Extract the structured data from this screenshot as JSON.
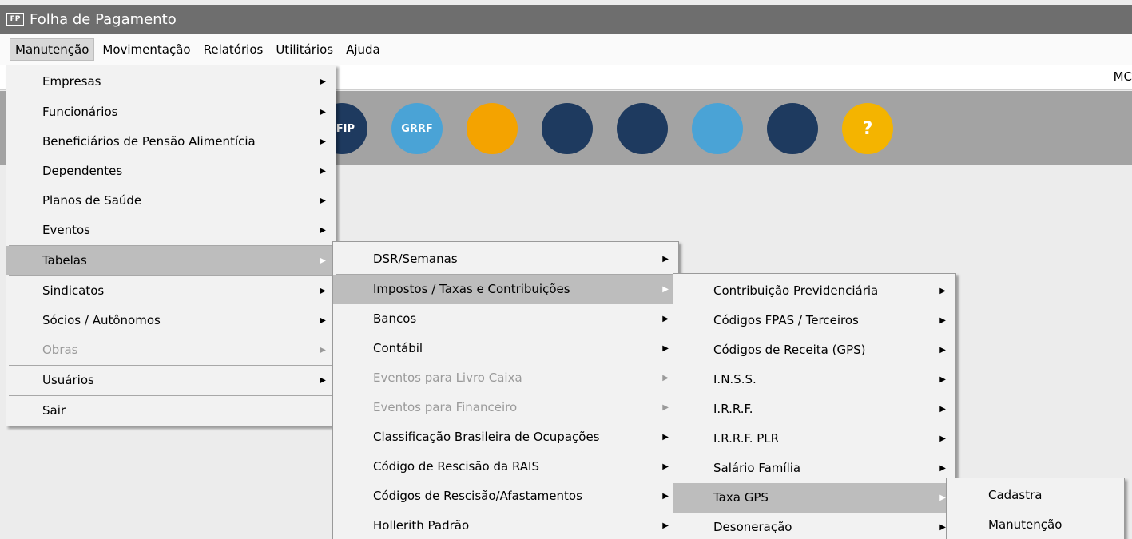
{
  "window": {
    "icon_text": "FP",
    "title": "Folha de Pagamento"
  },
  "menubar": [
    "Manutenção",
    "Movimentação",
    "Relatórios",
    "Utilitários",
    "Ajuda"
  ],
  "strip": {
    "right_text": "MC"
  },
  "toolbar": {
    "icons": [
      {
        "name": "sefip-icon",
        "text": "EFIP",
        "color": "#1e3a5f"
      },
      {
        "name": "grrf-icon",
        "text": "GRRF",
        "color": "#4aa3d6"
      },
      {
        "name": "document-icon",
        "text": "",
        "color": "#f4a300"
      },
      {
        "name": "support-agent-icon",
        "text": "",
        "color": "#1e3a5f"
      },
      {
        "name": "meeting-icon",
        "text": "",
        "color": "#1e3a5f"
      },
      {
        "name": "remote-access-icon",
        "text": "",
        "color": "#4aa3d6"
      },
      {
        "name": "database-icon",
        "text": "",
        "color": "#1e3a5f"
      },
      {
        "name": "help-chat-icon",
        "text": "?",
        "color": "#f4b400"
      }
    ]
  },
  "menu1": {
    "items": [
      {
        "label": "Empresas",
        "arrow": true,
        "disabled": false,
        "sep_after": true
      },
      {
        "label": "Funcionários",
        "arrow": true,
        "disabled": false
      },
      {
        "label": "Beneficiários de Pensão Alimentícia",
        "arrow": true,
        "disabled": false
      },
      {
        "label": "Dependentes",
        "arrow": true,
        "disabled": false
      },
      {
        "label": "Planos de Saúde",
        "arrow": true,
        "disabled": false
      },
      {
        "label": "Eventos",
        "arrow": true,
        "disabled": false,
        "sep_after": true
      },
      {
        "label": "Tabelas",
        "arrow": true,
        "disabled": false,
        "highlight": true,
        "sep_after": true
      },
      {
        "label": "Sindicatos",
        "arrow": true,
        "disabled": false
      },
      {
        "label": "Sócios / Autônomos",
        "arrow": true,
        "disabled": false
      },
      {
        "label": "Obras",
        "arrow": true,
        "disabled": true,
        "sep_after": true
      },
      {
        "label": "Usuários",
        "arrow": true,
        "disabled": false,
        "sep_after": true
      },
      {
        "label": "Sair",
        "arrow": false,
        "disabled": false
      }
    ]
  },
  "menu2": {
    "items": [
      {
        "label": "DSR/Semanas",
        "arrow": true,
        "sep_after": true
      },
      {
        "label": "Impostos / Taxas e Contribuições",
        "arrow": true,
        "highlight": true
      },
      {
        "label": "Bancos",
        "arrow": true
      },
      {
        "label": "Contábil",
        "arrow": true
      },
      {
        "label": "Eventos para Livro Caixa",
        "arrow": true,
        "disabled": true
      },
      {
        "label": "Eventos para Financeiro",
        "arrow": true,
        "disabled": true
      },
      {
        "label": "Classificação Brasileira de Ocupações",
        "arrow": true
      },
      {
        "label": "Código de Rescisão da RAIS",
        "arrow": true
      },
      {
        "label": "Códigos de Rescisão/Afastamentos",
        "arrow": true
      },
      {
        "label": "Hollerith Padrão",
        "arrow": true
      }
    ]
  },
  "menu3": {
    "items": [
      {
        "label": "Contribuição Previdenciária",
        "arrow": true
      },
      {
        "label": "Códigos FPAS / Terceiros",
        "arrow": true
      },
      {
        "label": "Códigos de Receita (GPS)",
        "arrow": true
      },
      {
        "label": "I.N.S.S.",
        "arrow": true
      },
      {
        "label": "I.R.R.F.",
        "arrow": true
      },
      {
        "label": "I.R.R.F. PLR",
        "arrow": true
      },
      {
        "label": "Salário Família",
        "arrow": true
      },
      {
        "label": "Taxa GPS",
        "arrow": true,
        "highlight": true
      },
      {
        "label": "Desoneração",
        "arrow": true
      }
    ]
  },
  "menu4": {
    "items": [
      {
        "label": "Cadastra",
        "arrow": false
      },
      {
        "label": "Manutenção",
        "arrow": false
      }
    ]
  },
  "arrow_glyph": "▶"
}
